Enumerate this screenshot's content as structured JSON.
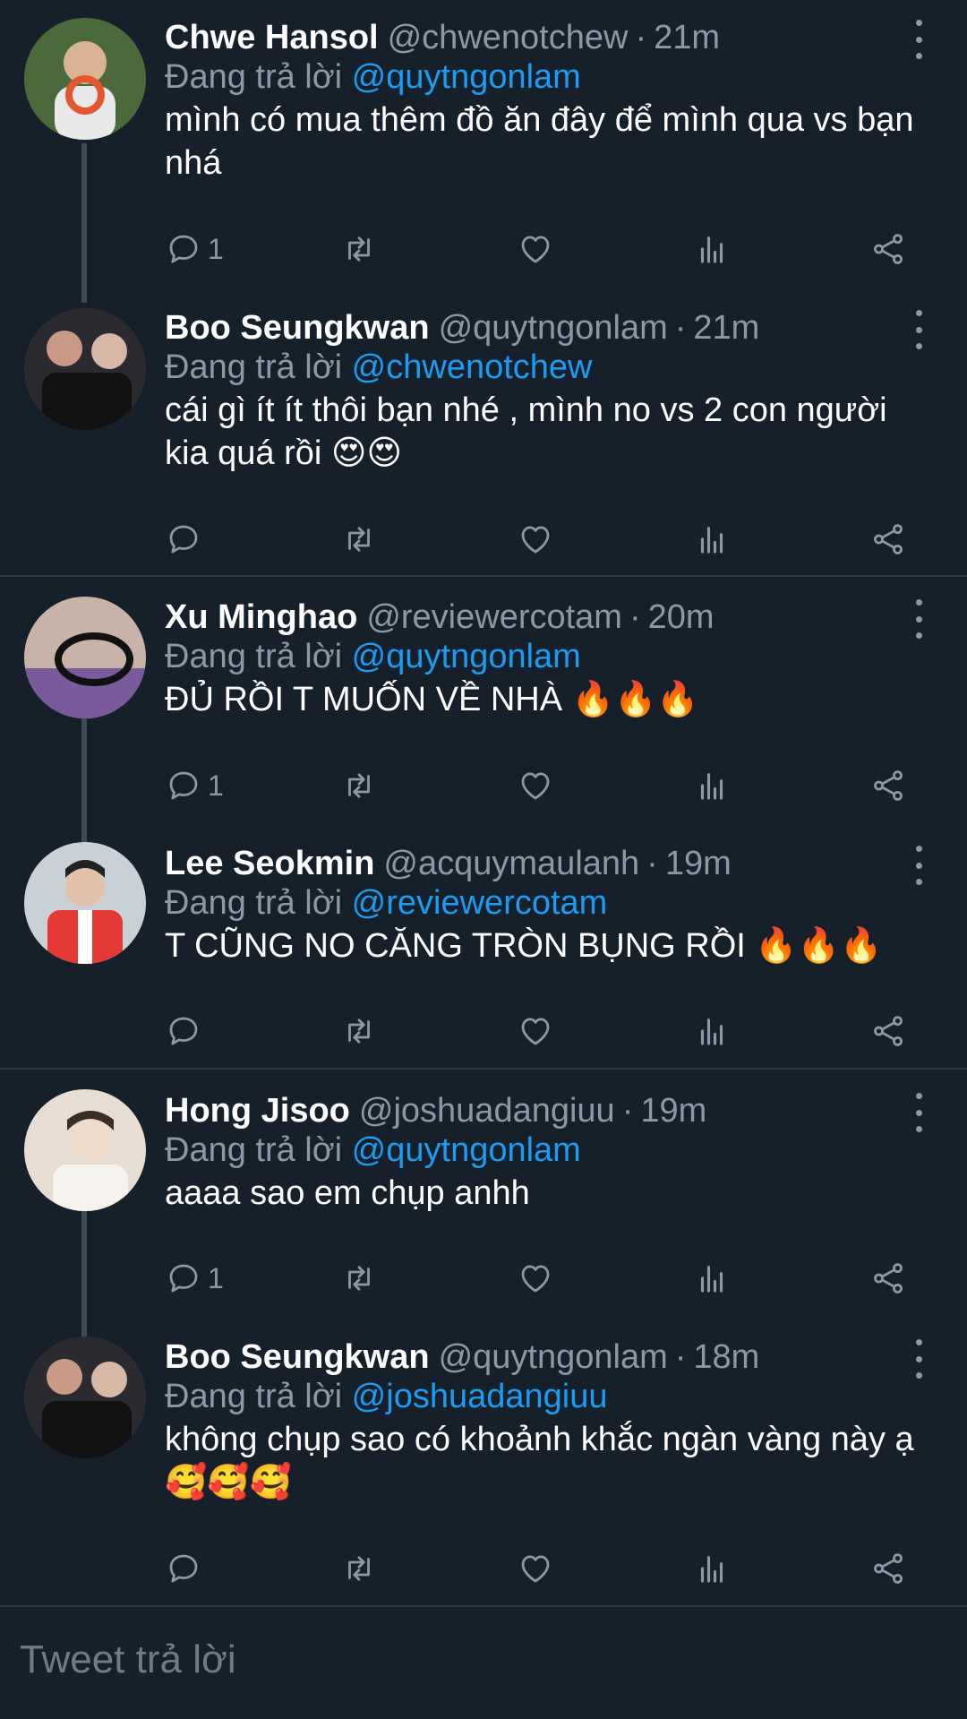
{
  "tweets": [
    {
      "name": "Chwe Hansol",
      "handle": "@chwenotchew",
      "time": "21m",
      "replying_prefix": "Đang trả lời",
      "replying_to": "@quytngonlam",
      "text": "mình có mua thêm đồ ăn đây để mình qua vs bạn nhá",
      "reply_count": "1",
      "avatar_color": "#4a6a3c"
    },
    {
      "name": "Boo Seungkwan",
      "handle": "@quytngonlam",
      "time": "21m",
      "replying_prefix": "Đang trả lời",
      "replying_to": "@chwenotchew",
      "text": "cái gì ít ít thôi bạn nhé , mình no vs 2 con người kia quá rồi 😍😍",
      "reply_count": "",
      "avatar_color": "#2a2a30"
    },
    {
      "name": "Xu Minghao",
      "handle": "@reviewercotam",
      "time": "20m",
      "replying_prefix": "Đang trả lời",
      "replying_to": "@quytngonlam",
      "text": "ĐỦ RỒI T MUỐN VỀ NHÀ 🔥🔥🔥",
      "reply_count": "1",
      "avatar_color": "#7a5a9a"
    },
    {
      "name": "Lee Seokmin",
      "handle": "@acquymaulanh",
      "time": "19m",
      "replying_prefix": "Đang trả lời",
      "replying_to": "@reviewercotam",
      "text": "T CŨNG NO CĂNG TRÒN BỤNG RỒI 🔥🔥🔥",
      "reply_count": "",
      "avatar_color": "#c9d1d6"
    },
    {
      "name": "Hong Jisoo",
      "handle": "@joshuadangiuu",
      "time": "19m",
      "replying_prefix": "Đang trả lời",
      "replying_to": "@quytngonlam",
      "text": "aaaa sao em chụp anhh",
      "reply_count": "1",
      "avatar_color": "#e7ddd2"
    },
    {
      "name": "Boo Seungkwan",
      "handle": "@quytngonlam",
      "time": "18m",
      "replying_prefix": "Đang trả lời",
      "replying_to": "@joshuadangiuu",
      "text": "không chụp sao có khoảnh khắc ngàn vàng này ạ 🥰🥰🥰",
      "reply_count": "",
      "avatar_color": "#2a2a30"
    }
  ],
  "sep": "·",
  "reply_box": {
    "placeholder": "Tweet trả lời"
  },
  "icons": [
    "reply-icon",
    "retweet-icon",
    "like-icon",
    "analytics-icon",
    "share-icon",
    "more-icon"
  ],
  "colors": {
    "background": "#15202b",
    "mention": "#1d9bf0",
    "muted": "#8b98a5"
  }
}
